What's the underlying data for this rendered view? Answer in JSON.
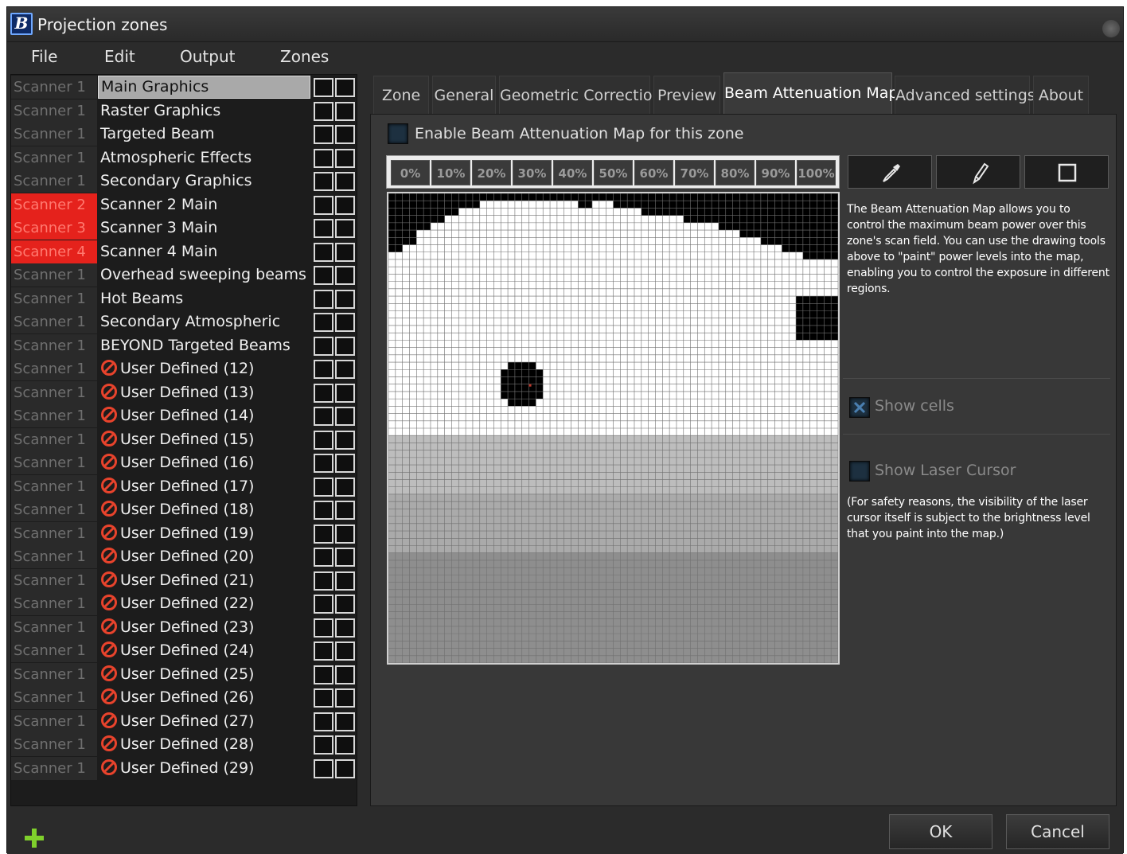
{
  "window": {
    "title": "Projection zones"
  },
  "menu": [
    "File",
    "Edit",
    "Output",
    "Zones"
  ],
  "zones": [
    {
      "scanner": "Scanner 1",
      "name": "Main Graphics",
      "selected": true,
      "red": false,
      "icon": ""
    },
    {
      "scanner": "Scanner 1",
      "name": "Raster Graphics",
      "red": false,
      "icon": ""
    },
    {
      "scanner": "Scanner 1",
      "name": "Targeted Beam",
      "red": false,
      "icon": ""
    },
    {
      "scanner": "Scanner 1",
      "name": "Atmospheric Effects",
      "red": false,
      "icon": ""
    },
    {
      "scanner": "Scanner 1",
      "name": "Secondary Graphics",
      "red": false,
      "icon": ""
    },
    {
      "scanner": "Scanner 2",
      "name": "Scanner 2 Main",
      "red": true,
      "icon": ""
    },
    {
      "scanner": "Scanner 3",
      "name": "Scanner 3 Main",
      "red": true,
      "icon": ""
    },
    {
      "scanner": "Scanner 4",
      "name": "Scanner 4 Main",
      "red": true,
      "icon": ""
    },
    {
      "scanner": "Scanner 1",
      "name": "Overhead sweeping beams",
      "red": false,
      "icon": ""
    },
    {
      "scanner": "Scanner 1",
      "name": "Hot Beams",
      "red": false,
      "icon": ""
    },
    {
      "scanner": "Scanner 1",
      "name": "Secondary Atmospheric",
      "red": false,
      "icon": ""
    },
    {
      "scanner": "Scanner 1",
      "name": "BEYOND Targeted Beams",
      "red": false,
      "icon": ""
    },
    {
      "scanner": "Scanner 1",
      "name": "User Defined (12)",
      "red": false,
      "icon": "disabled-icon"
    },
    {
      "scanner": "Scanner 1",
      "name": "User Defined (13)",
      "red": false,
      "icon": "disabled-icon"
    },
    {
      "scanner": "Scanner 1",
      "name": "User Defined (14)",
      "red": false,
      "icon": "disabled-icon"
    },
    {
      "scanner": "Scanner 1",
      "name": "User Defined (15)",
      "red": false,
      "icon": "disabled-icon"
    },
    {
      "scanner": "Scanner 1",
      "name": "User Defined (16)",
      "red": false,
      "icon": "disabled-icon"
    },
    {
      "scanner": "Scanner 1",
      "name": "User Defined (17)",
      "red": false,
      "icon": "disabled-icon"
    },
    {
      "scanner": "Scanner 1",
      "name": "User Defined (18)",
      "red": false,
      "icon": "disabled-icon"
    },
    {
      "scanner": "Scanner 1",
      "name": "User Defined (19)",
      "red": false,
      "icon": "disabled-icon"
    },
    {
      "scanner": "Scanner 1",
      "name": "User Defined (20)",
      "red": false,
      "icon": "disabled-icon"
    },
    {
      "scanner": "Scanner 1",
      "name": "User Defined (21)",
      "red": false,
      "icon": "disabled-icon"
    },
    {
      "scanner": "Scanner 1",
      "name": "User Defined (22)",
      "red": false,
      "icon": "disabled-icon"
    },
    {
      "scanner": "Scanner 1",
      "name": "User Defined (23)",
      "red": false,
      "icon": "disabled-icon"
    },
    {
      "scanner": "Scanner 1",
      "name": "User Defined (24)",
      "red": false,
      "icon": "disabled-icon"
    },
    {
      "scanner": "Scanner 1",
      "name": "User Defined (25)",
      "red": false,
      "icon": "disabled-icon"
    },
    {
      "scanner": "Scanner 1",
      "name": "User Defined (26)",
      "red": false,
      "icon": "disabled-icon"
    },
    {
      "scanner": "Scanner 1",
      "name": "User Defined (27)",
      "red": false,
      "icon": "disabled-icon"
    },
    {
      "scanner": "Scanner 1",
      "name": "User Defined (28)",
      "red": false,
      "icon": "disabled-icon"
    },
    {
      "scanner": "Scanner 1",
      "name": "User Defined (29)",
      "red": false,
      "icon": "disabled-icon"
    }
  ],
  "tabs": [
    "Zone",
    "General",
    "Geometric Correction",
    "Preview",
    "Beam Attenuation Map",
    "Advanced settings",
    "About"
  ],
  "active_tab": "Beam Attenuation Map",
  "panel": {
    "enable_label": "Enable Beam Attenuation Map for this zone",
    "levels": [
      "0%",
      "10%",
      "20%",
      "30%",
      "40%",
      "50%",
      "60%",
      "70%",
      "80%",
      "90%",
      "100%"
    ],
    "tools": [
      "eyedropper-icon",
      "pencil-icon",
      "rectangle-icon"
    ],
    "info": "The Beam Attenuation Map allows you to control the maximum beam power over this zone's scan field. You can use the drawing tools above to \"paint\" power levels into the map, enabling you to control the exposure in different regions.",
    "show_cells_label": "Show cells",
    "show_cells_checked": true,
    "show_cursor_label": "Show Laser Cursor",
    "show_cursor_checked": false,
    "note": "(For safety reasons, the visibility of the laser cursor itself is subject to the brightness level that you paint into the map.)"
  },
  "buttons": {
    "ok": "OK",
    "cancel": "Cancel"
  },
  "colors": {
    "accent": "#e5221c",
    "panel": "#383838",
    "list": "#1c1c1c"
  }
}
